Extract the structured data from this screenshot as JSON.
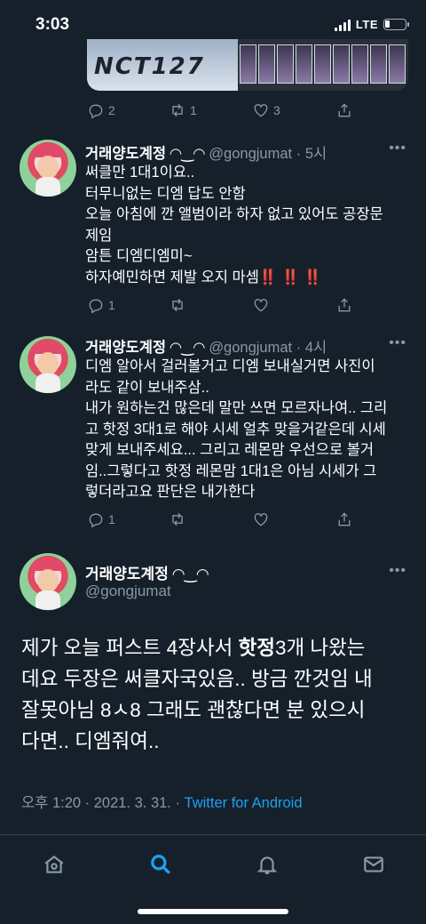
{
  "status_bar": {
    "time": "3:03",
    "network": "LTE"
  },
  "quoted_media": {
    "logo_text": "NCT127"
  },
  "top_tweet_actions": {
    "replies": "2",
    "retweets": "1",
    "likes": "3"
  },
  "replies": [
    {
      "display_name": "거래양도계정 ◠‿◠",
      "handle": "@gongjumat",
      "separator": "·",
      "time": "5시",
      "lines": [
        "써클만 1대1이요..",
        "터무니없는 디엠 답도 안함",
        "오늘 아침에 깐 앨범이라 하자 없고 있어도 공장문",
        "제임",
        "암튼 디엠디엠미~",
        "하자예민하면 제발 오지 마셈"
      ],
      "emphasis": "‼️ ‼️ ‼️",
      "reply_count": "1",
      "retweet_count": "",
      "like_count": ""
    },
    {
      "display_name": "거래양도계정 ◠‿◠",
      "handle": "@gongjumat",
      "separator": "·",
      "time": "4시",
      "lines": [
        "디엠 알아서 걸러볼거고 디엠 보내실거면 사진이",
        "라도 같이 보내주삼..",
        "내가 원하는건 많은데 말만 쓰면 모르자나여.. 그리",
        "고 핫정 3대1로 해야 시세 얼추 맞을거같은데 시세",
        "맞게 보내주세요... 그리고 레몬맘 우선으로 볼거",
        "임..그렇다고 핫정 레몬맘 1대1은 아님 시세가 그",
        "렇더라고요 판단은 내가한다"
      ],
      "reply_count": "1",
      "retweet_count": "",
      "like_count": ""
    }
  ],
  "main_tweet": {
    "display_name": "거래양도계정 ◠‿◠",
    "handle": "@gongjumat",
    "line1_before": "제가 오늘 퍼스트 4장사서 ",
    "line1_bold": "핫정",
    "line1_after": "3개 나왔는",
    "lines_rest": [
      "데요 두장은 써클자국있음.. 방금 깐것임 내",
      "잘못아님 8ㅅ8 그래도 괜찮다면 분 있으시",
      "다면.. 디엠줘여.."
    ],
    "timestamp": "오후 1:20 · 2021. 3. 31. · ",
    "source": "Twitter for Android"
  },
  "tab_bar": [
    "home",
    "search",
    "notifications",
    "messages"
  ],
  "colors": {
    "background": "#15202b",
    "accent": "#1da1f2",
    "muted": "#8899a6",
    "alert": "#e0245e"
  }
}
